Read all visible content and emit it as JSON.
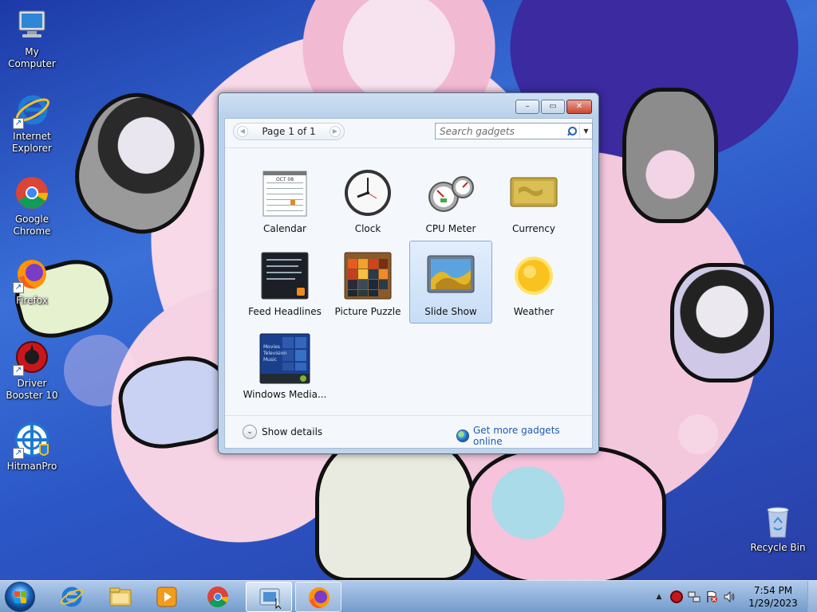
{
  "desktop": {
    "icons": [
      {
        "label": "My Computer",
        "icon": "computer-icon"
      },
      {
        "label": "Internet Explorer",
        "icon": "ie-icon"
      },
      {
        "label": "Google Chrome",
        "icon": "chrome-icon"
      },
      {
        "label": "Firefox",
        "icon": "firefox-icon"
      },
      {
        "label": "Driver Booster 10",
        "icon": "driver-booster-icon"
      },
      {
        "label": "HitmanPro",
        "icon": "hitmanpro-icon"
      },
      {
        "label": "Recycle Bin",
        "icon": "recycle-bin-icon"
      }
    ]
  },
  "gadget_window": {
    "window_buttons": {
      "minimize": "–",
      "restore": "▭",
      "close": "✕"
    },
    "pager": {
      "prev": "◀",
      "label": "Page 1 of 1",
      "next": "▶"
    },
    "search": {
      "placeholder": "Search gadgets",
      "dropdown": "▼"
    },
    "gadgets": [
      {
        "label": "Calendar",
        "icon": "calendar-gadget-icon",
        "selected": false,
        "month": "OCT 08"
      },
      {
        "label": "Clock",
        "icon": "clock-gadget-icon",
        "selected": false
      },
      {
        "label": "CPU Meter",
        "icon": "cpu-meter-gadget-icon",
        "selected": false
      },
      {
        "label": "Currency",
        "icon": "currency-gadget-icon",
        "selected": false
      },
      {
        "label": "Feed Headlines",
        "icon": "feed-headlines-gadget-icon",
        "selected": false
      },
      {
        "label": "Picture Puzzle",
        "icon": "picture-puzzle-gadget-icon",
        "selected": false
      },
      {
        "label": "Slide Show",
        "icon": "slide-show-gadget-icon",
        "selected": true
      },
      {
        "label": "Weather",
        "icon": "weather-gadget-icon",
        "selected": false
      },
      {
        "label": "Windows Media...",
        "icon": "windows-media-center-gadget-icon",
        "selected": false,
        "menu": [
          "Movies",
          "Television",
          "Music"
        ]
      }
    ],
    "footer": {
      "show_details": "Show details",
      "show_details_chevron": "⌄",
      "get_more": "Get more gadgets online"
    }
  },
  "taskbar": {
    "pinned": [
      "internet-explorer",
      "windows-explorer",
      "windows-media-player",
      "google-chrome",
      "gadgets",
      "firefox"
    ],
    "clock": {
      "time": "7:54 PM",
      "date": "1/29/2023"
    },
    "tray_expand": "▲"
  },
  "colors": {
    "window_frame": "#b9d1eb",
    "link": "#1f5ab4",
    "selected_bg": "#c8ddf6",
    "close_button": "#c9452e"
  }
}
